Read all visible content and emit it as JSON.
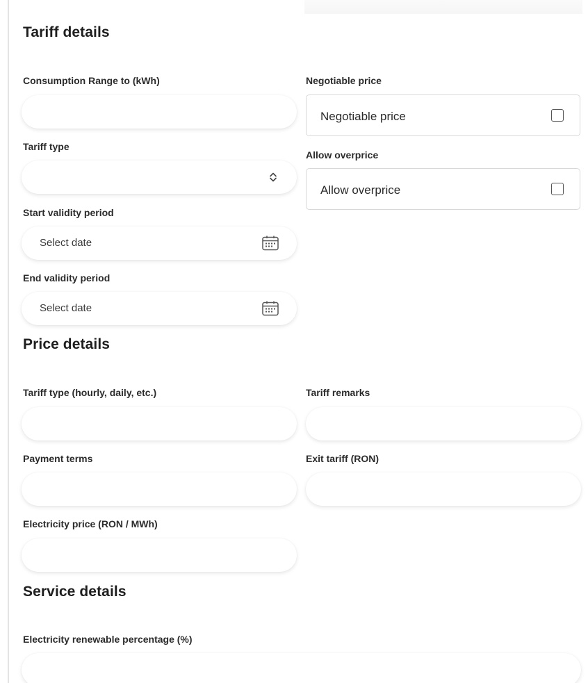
{
  "sections": {
    "tariff_details": {
      "title": "Tariff details",
      "consumption_range": {
        "label": "Consumption Range to (kWh)",
        "value": ""
      },
      "negotiable_price": {
        "label": "Negotiable price",
        "checkbox_label": "Negotiable price",
        "checked": false
      },
      "tariff_type": {
        "label": "Tariff type",
        "value": "",
        "icon": "select-chevron-icon"
      },
      "allow_overprice": {
        "label": "Allow overprice",
        "checkbox_label": "Allow overprice",
        "checked": false
      },
      "start_validity": {
        "label": "Start validity period",
        "placeholder": "Select date",
        "icon": "calendar-icon"
      },
      "end_validity": {
        "label": "End validity period",
        "placeholder": "Select date",
        "icon": "calendar-icon"
      }
    },
    "price_details": {
      "title": "Price details",
      "tariff_type_period": {
        "label": "Tariff type (hourly, daily, etc.)",
        "value": ""
      },
      "tariff_remarks": {
        "label": "Tariff remarks",
        "value": ""
      },
      "payment_terms": {
        "label": "Payment terms",
        "value": ""
      },
      "exit_tariff": {
        "label": "Exit tariff (RON)",
        "value": ""
      },
      "electricity_price": {
        "label": "Electricity price (RON / MWh)",
        "value": ""
      }
    },
    "service_details": {
      "title": "Service details",
      "renewable_percentage": {
        "label": "Electricity renewable percentage (%)",
        "value": ""
      }
    }
  }
}
